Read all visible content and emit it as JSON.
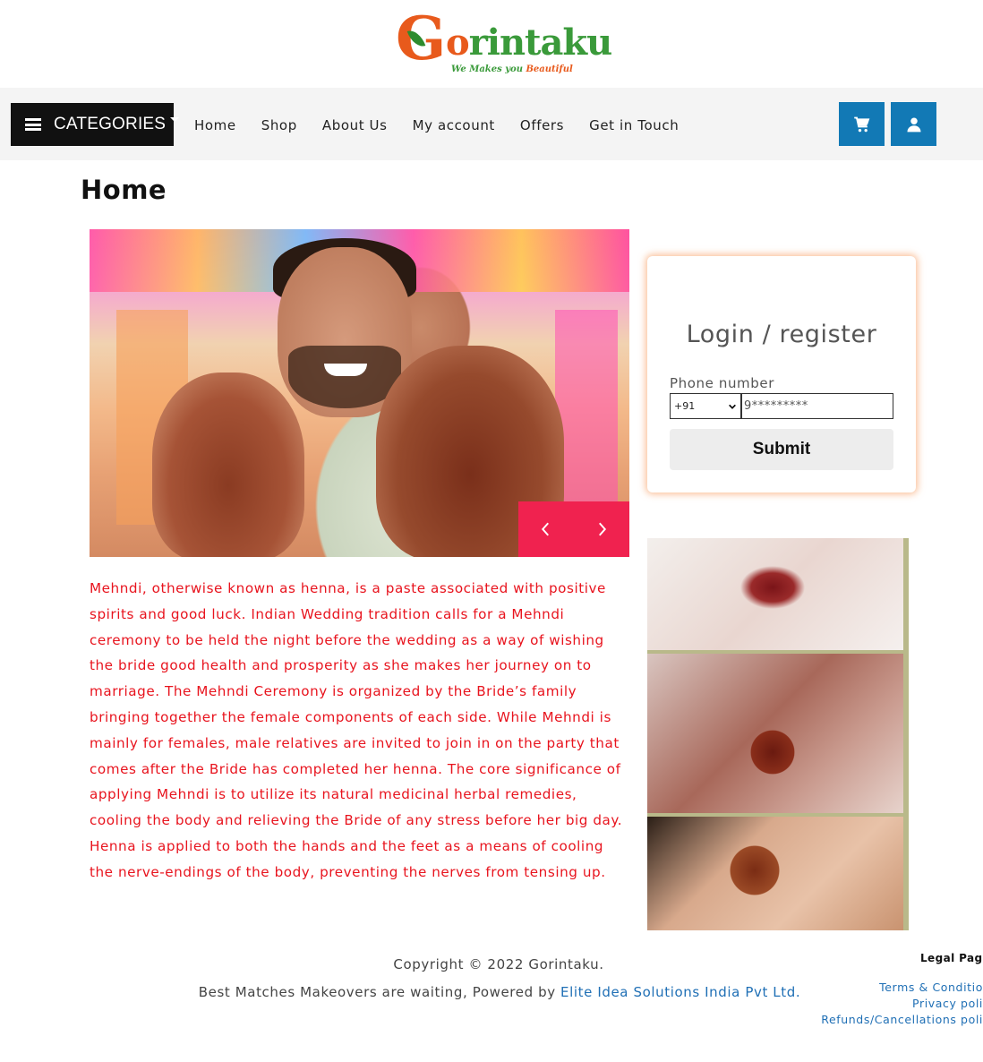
{
  "brand": {
    "logo_initial": "G",
    "logo_text_o": "o",
    "logo_text_rest": "rintaku",
    "tagline_pre": "We Makes you ",
    "tagline_post": "Beautiful"
  },
  "nav": {
    "categories_label": "CATEGORIES",
    "links": [
      "Home",
      "Shop",
      "About Us",
      "My account",
      "Offers",
      "Get in Touch"
    ]
  },
  "page": {
    "title": "Home"
  },
  "description": "Mehndi, otherwise known as henna, is a paste associated with positive spirits and good luck. Indian Wedding tradition calls for a Mehndi ceremony to be held the night before the wedding as a way of wishing the bride good health and prosperity as she makes her journey on to marriage. The Mehndi Ceremony is organized by the Bride’s family bringing together the female components of each side. While Mehndi is mainly for females, male relatives are invited to join in on the party that comes after the Bride has completed her henna. The core significance of applying Mehndi is to utilize its natural medicinal herbal remedies, cooling the body and relieving the Bride of any stress before her big day. Henna is applied to both the hands and the feet as a means of cooling the nerve-endings of the body, preventing the nerves from tensing up.",
  "login": {
    "title": "Login / register",
    "phone_label": "Phone number",
    "country_code": "+91",
    "phone_value": "9*********",
    "submit_label": "Submit"
  },
  "footer": {
    "copyright": "Copyright © 2022 Gorintaku.",
    "powered_text": "Best Matches Makeovers are waiting, Powered by ",
    "powered_link": "Elite Idea Solutions India Pvt Ltd.",
    "legal_title": "Legal Pag",
    "legal_links": [
      "Terms & Conditio",
      "Privacy poli",
      "Refunds/Cancellations poli"
    ]
  },
  "colors": {
    "accent_blue": "#1279b5",
    "slider_nav": "#f0224f",
    "description_text": "#e8141e",
    "logo_orange": "#e85a1c",
    "logo_green": "#3a9a3a"
  },
  "icons": {
    "menu": "hamburger-icon",
    "cart": "cart-icon",
    "user": "user-icon",
    "prev": "chevron-left-icon",
    "next": "chevron-right-icon",
    "select": "chevron-down-icon"
  }
}
